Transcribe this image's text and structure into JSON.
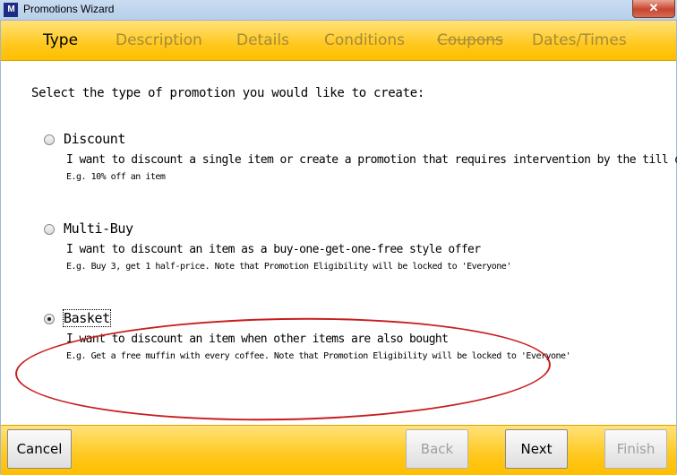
{
  "window": {
    "title": "Promotions Wizard",
    "app_icon_text": "M",
    "close_glyph": "✕"
  },
  "tabs": [
    {
      "label": "Type",
      "state": "active"
    },
    {
      "label": "Description",
      "state": "inactive"
    },
    {
      "label": "Details",
      "state": "inactive"
    },
    {
      "label": "Conditions",
      "state": "inactive"
    },
    {
      "label": "Coupons",
      "state": "disabled"
    },
    {
      "label": "Dates/Times",
      "state": "inactive"
    }
  ],
  "content": {
    "prompt": "Select the type of promotion you would like to create:",
    "options": [
      {
        "label": "Discount",
        "description": "I want to discount a single item or create a promotion that requires intervention by the till operator",
        "example": "E.g. 10% off an item",
        "selected": false
      },
      {
        "label": "Multi-Buy",
        "description": "I want to discount an item as a buy-one-get-one-free style offer",
        "example": "E.g. Buy 3, get 1 half-price.  Note that Promotion Eligibility will be locked to 'Everyone'",
        "selected": false
      },
      {
        "label": "Basket",
        "description": "I want to discount an item when other items are also bought",
        "example": "E.g. Get a free muffin with every coffee.  Note that Promotion Eligibility will be locked to 'Everyone'",
        "selected": true
      }
    ]
  },
  "footer": {
    "cancel": "Cancel",
    "back": "Back",
    "next": "Next",
    "finish": "Finish"
  },
  "colors": {
    "tabbar": "#ffc81e",
    "annotation": "#c81e1e"
  }
}
